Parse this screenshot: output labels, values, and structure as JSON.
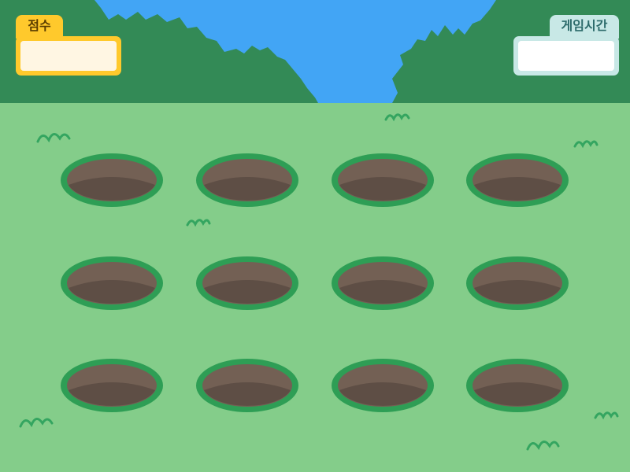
{
  "hud": {
    "score_label": "점수",
    "score_value": "",
    "time_label": "게임시간",
    "time_value": ""
  },
  "board": {
    "rows": 3,
    "cols": 4,
    "holes": [
      {
        "row": 1,
        "col": 1
      },
      {
        "row": 1,
        "col": 2
      },
      {
        "row": 1,
        "col": 3
      },
      {
        "row": 1,
        "col": 4
      },
      {
        "row": 2,
        "col": 1
      },
      {
        "row": 2,
        "col": 2
      },
      {
        "row": 2,
        "col": 3
      },
      {
        "row": 2,
        "col": 4
      },
      {
        "row": 3,
        "col": 1
      },
      {
        "row": 3,
        "col": 2
      },
      {
        "row": 3,
        "col": 3
      },
      {
        "row": 3,
        "col": 4
      }
    ]
  },
  "colors": {
    "sky": "#42a5f5",
    "trees": "#338a56",
    "grass": "#84cd8a",
    "hole_rim": "#2e9e55",
    "hole_dirt": "#736054",
    "hole_shadow": "#5e4e45",
    "grass_tuft": "#34a560",
    "score_accent": "#ffc92c",
    "time_accent": "#c8e8e6"
  }
}
